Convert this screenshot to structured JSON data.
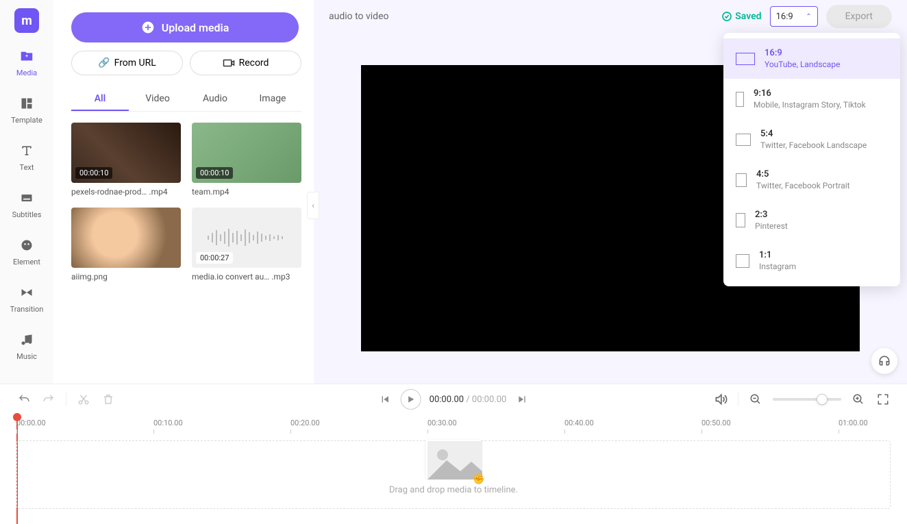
{
  "project": {
    "title": "audio to video",
    "saved_label": "Saved",
    "export_label": "Export"
  },
  "aspect": {
    "current": "16:9",
    "options": [
      {
        "ratio": "16:9",
        "desc": "YouTube, Landscape"
      },
      {
        "ratio": "9:16",
        "desc": "Mobile, Instagram Story, Tiktok"
      },
      {
        "ratio": "5:4",
        "desc": "Twitter, Facebook Landscape"
      },
      {
        "ratio": "4:5",
        "desc": "Twitter, Facebook Portrait"
      },
      {
        "ratio": "2:3",
        "desc": "Pinterest"
      },
      {
        "ratio": "1:1",
        "desc": "Instagram"
      }
    ]
  },
  "sidebar": {
    "items": [
      {
        "label": "Media"
      },
      {
        "label": "Template"
      },
      {
        "label": "Text"
      },
      {
        "label": "Subtitles"
      },
      {
        "label": "Element"
      },
      {
        "label": "Transition"
      },
      {
        "label": "Music"
      }
    ]
  },
  "media_panel": {
    "upload_label": "Upload media",
    "from_url_label": "From URL",
    "record_label": "Record",
    "tabs": [
      {
        "label": "All"
      },
      {
        "label": "Video"
      },
      {
        "label": "Audio"
      },
      {
        "label": "Image"
      }
    ],
    "items": [
      {
        "name": "pexels-rodnae-prod… .mp4",
        "duration": "00:00:10"
      },
      {
        "name": "team.mp4",
        "duration": "00:00:10"
      },
      {
        "name": "aiimg.png",
        "duration": ""
      },
      {
        "name": "media.io convert au… .mp3",
        "duration": "00:00:27"
      }
    ]
  },
  "timeline": {
    "current": "00:00.00",
    "total": "00:00.00",
    "marks": [
      "00:00.00",
      "00:10.00",
      "00:20.00",
      "00:30.00",
      "00:40.00",
      "00:50.00",
      "01:00.00"
    ],
    "dropzone_text": "Drag and drop media to timeline."
  },
  "colors": {
    "accent": "#6f56f5",
    "success": "#00b894",
    "playhead": "#e74c3c"
  }
}
